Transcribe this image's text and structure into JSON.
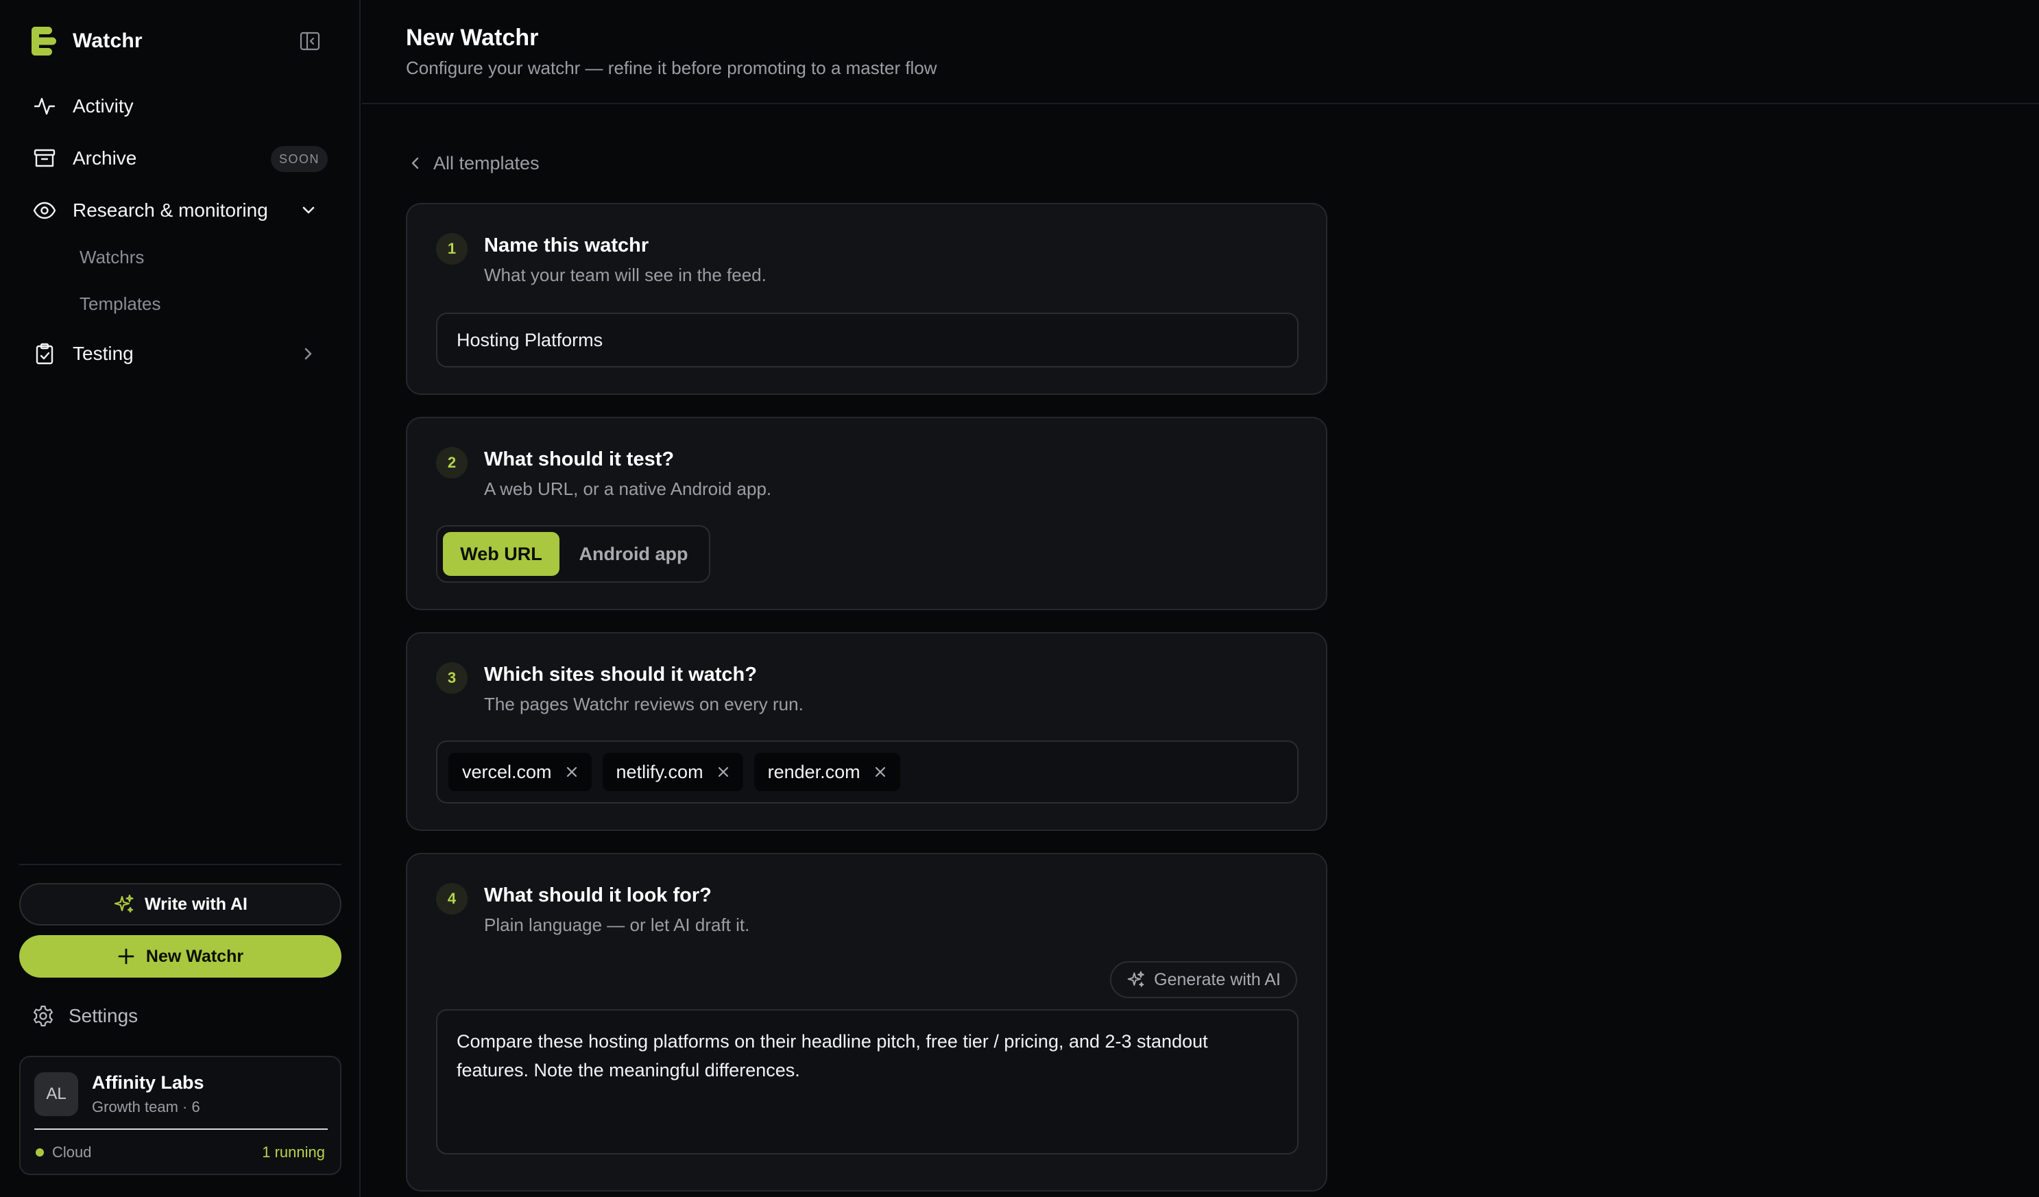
{
  "app": {
    "name": "Watchr"
  },
  "colors": {
    "accent": "#a9c83f",
    "background": "#07080a",
    "card": "#121316"
  },
  "sidebar": {
    "items": [
      {
        "label": "Activity",
        "icon": "activity-icon"
      },
      {
        "label": "Archive",
        "icon": "archive-icon",
        "badge": "SOON"
      },
      {
        "label": "Research & monitoring",
        "icon": "eye-icon",
        "expanded": true,
        "children": [
          {
            "label": "Watchrs"
          },
          {
            "label": "Templates"
          }
        ]
      },
      {
        "label": "Testing",
        "icon": "clipboard-check-icon",
        "expanded": false
      }
    ],
    "write_ai_label": "Write with AI",
    "new_watchr_label": "New Watchr",
    "settings_label": "Settings",
    "org": {
      "initials": "AL",
      "name": "Affinity Labs",
      "subtitle": "Growth team · 6",
      "env": "Cloud",
      "running": "1 running"
    }
  },
  "header": {
    "title": "New Watchr",
    "subtitle": "Configure your watchr — refine it before promoting to a master flow"
  },
  "back_label": "All templates",
  "steps": [
    {
      "num": "1",
      "title": "Name this watchr",
      "subtitle": "What your team will see in the feed.",
      "value": "Hosting Platforms"
    },
    {
      "num": "2",
      "title": "What should it test?",
      "subtitle": "A web URL, or a native Android app.",
      "options": [
        "Web URL",
        "Android app"
      ],
      "selected": "Web URL"
    },
    {
      "num": "3",
      "title": "Which sites should it watch?",
      "subtitle": "The pages Watchr reviews on every run.",
      "tags": [
        "vercel.com",
        "netlify.com",
        "render.com"
      ]
    },
    {
      "num": "4",
      "title": "What should it look for?",
      "subtitle": "Plain language — or let AI draft it.",
      "generate_label": "Generate with AI",
      "prompt": "Compare these hosting platforms on their headline pitch, free tier / pricing, and 2-3 standout features. Note the meaningful differences."
    }
  ]
}
